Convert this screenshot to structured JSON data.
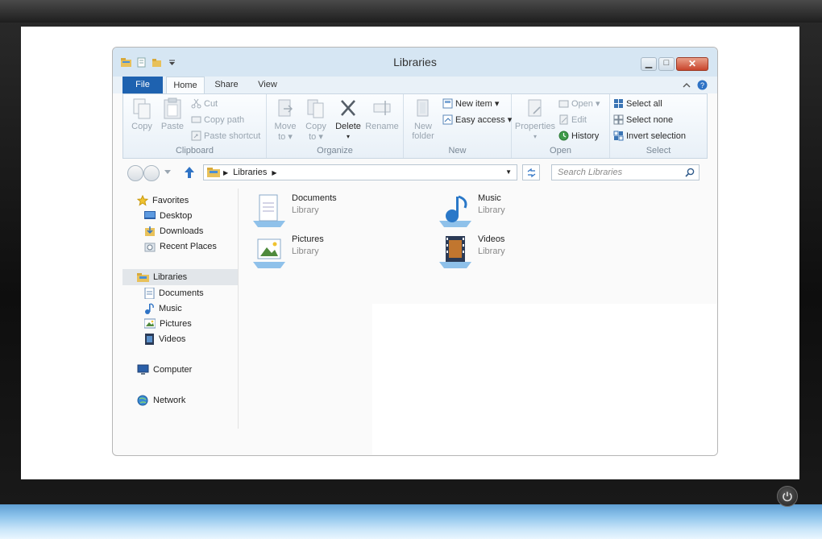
{
  "window": {
    "title": "Libraries"
  },
  "tabs": {
    "file": "File",
    "home": "Home",
    "share": "Share",
    "view": "View"
  },
  "ribbon": {
    "clipboard": {
      "label": "Clipboard",
      "copy": "Copy",
      "paste": "Paste",
      "cut": "Cut",
      "copy_path": "Copy path",
      "paste_shortcut": "Paste shortcut"
    },
    "organize": {
      "label": "Organize",
      "move_to": "Move",
      "move_to2": "to ▾",
      "copy_to": "Copy",
      "copy_to2": "to ▾",
      "delete": "Delete",
      "rename": "Rename"
    },
    "new": {
      "label": "New",
      "new_folder": "New",
      "new_folder2": "folder",
      "new_item": "New item ▾",
      "easy_access": "Easy access ▾"
    },
    "open": {
      "label": "Open",
      "properties": "Properties",
      "open": "Open ▾",
      "edit": "Edit",
      "history": "History"
    },
    "select": {
      "label": "Select",
      "select_all": "Select all",
      "select_none": "Select none",
      "invert_selection": "Invert selection"
    }
  },
  "address": {
    "path": "Libraries",
    "search_placeholder": "Search Libraries"
  },
  "nav": {
    "favorites": "Favorites",
    "desktop": "Desktop",
    "downloads": "Downloads",
    "recent_places": "Recent Places",
    "libraries": "Libraries",
    "documents": "Documents",
    "music": "Music",
    "pictures": "Pictures",
    "videos": "Videos",
    "computer": "Computer",
    "network": "Network"
  },
  "libraries": [
    {
      "name": "Documents",
      "type": "Library"
    },
    {
      "name": "Music",
      "type": "Library"
    },
    {
      "name": "Pictures",
      "type": "Library"
    },
    {
      "name": "Videos",
      "type": "Library"
    }
  ],
  "colors": {
    "accent": "#1e62b0",
    "titlebar": "#d6e6f3",
    "close": "#c9452c",
    "stripe": "#8ec4ec"
  },
  "icons": [
    "power-icon",
    "folder-icon",
    "star-icon",
    "desktop-icon",
    "download-icon",
    "library-icon",
    "document-icon",
    "music-icon",
    "picture-icon",
    "video-icon",
    "computer-icon",
    "network-icon",
    "search-icon",
    "up-arrow-icon",
    "refresh-icon",
    "help-icon"
  ]
}
